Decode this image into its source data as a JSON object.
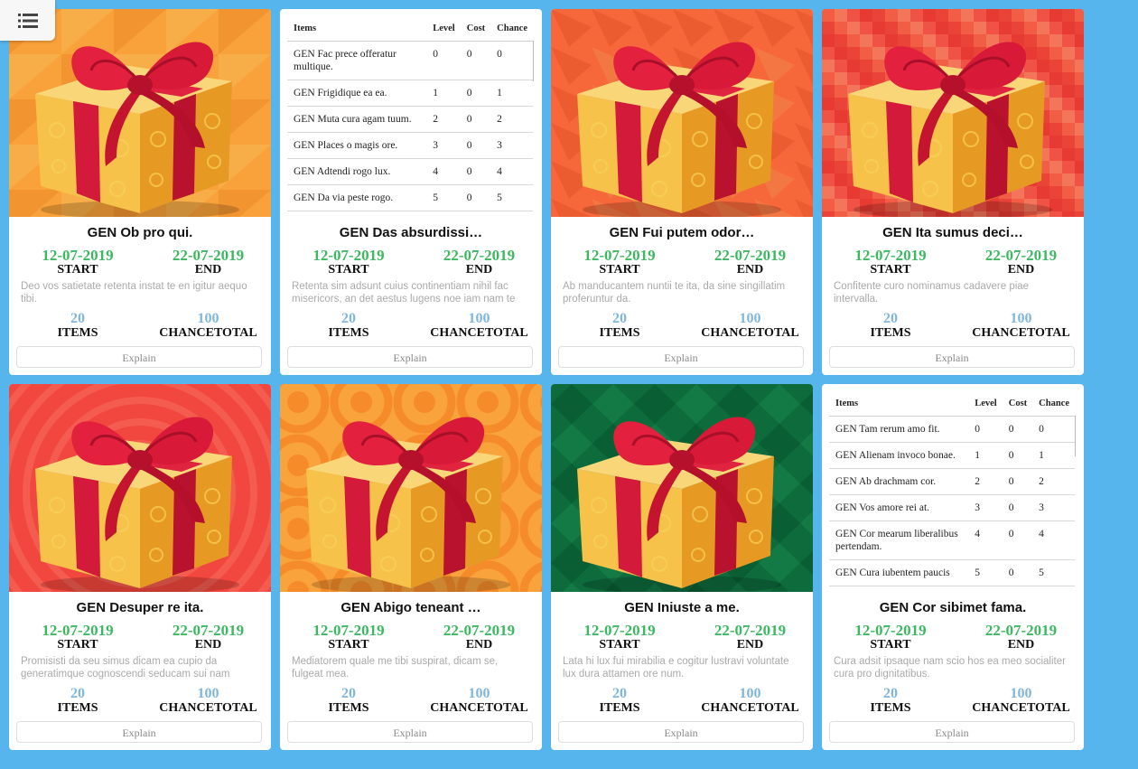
{
  "menu": {
    "icon": "hamburger-menu-icon"
  },
  "labels": {
    "start": "START",
    "end": "END",
    "items": "ITEMS",
    "chancetotal": "CHANCETOTAL",
    "explain": "Explain"
  },
  "table_headers": {
    "items": "Items",
    "level": "Level",
    "cost": "Cost",
    "chance": "Chance"
  },
  "colors": {
    "page_bg": "#56b5ed",
    "date_green": "#3cb860",
    "stat_blue": "#7eb6e0"
  },
  "cards": [
    {
      "view": "image",
      "bg": "orange-triangles",
      "title": "GEN Ob pro qui.",
      "start": "12-07-2019",
      "end": "22-07-2019",
      "desc": "Deo vos satietate retenta instat te en igitur aequo tibi.",
      "items": "20",
      "chancetotal": "100"
    },
    {
      "view": "table",
      "title": "GEN Das absurdissi…",
      "start": "12-07-2019",
      "end": "22-07-2019",
      "desc": "Retenta sim adsunt cuius continentiam nihil fac misericors, an det aestus lugens noe iam nam te",
      "items": "20",
      "chancetotal": "100",
      "rows": [
        {
          "name": "GEN Fac prece offeratur multique.",
          "level": "0",
          "cost": "0",
          "chance": "0"
        },
        {
          "name": "GEN Frigidique ea ea.",
          "level": "1",
          "cost": "0",
          "chance": "1"
        },
        {
          "name": "GEN Muta cura agam tuum.",
          "level": "2",
          "cost": "0",
          "chance": "2"
        },
        {
          "name": "GEN Places o magis ore.",
          "level": "3",
          "cost": "0",
          "chance": "3"
        },
        {
          "name": "GEN Adtendi rogo lux.",
          "level": "4",
          "cost": "0",
          "chance": "4"
        },
        {
          "name": "GEN Da via peste rogo.",
          "level": "5",
          "cost": "0",
          "chance": "5"
        }
      ]
    },
    {
      "view": "image",
      "bg": "orange-polygons",
      "title": "GEN Fui putem odor…",
      "start": "12-07-2019",
      "end": "22-07-2019",
      "desc": "Ab manducantem nuntii te ita, da sine singillatim proferuntur da.",
      "items": "20",
      "chancetotal": "100"
    },
    {
      "view": "image",
      "bg": "red-pixels",
      "title": "GEN Ita sumus deci…",
      "start": "12-07-2019",
      "end": "22-07-2019",
      "desc": "Confitente curo nominamus cadavere piae intervalla.",
      "items": "20",
      "chancetotal": "100"
    },
    {
      "view": "image",
      "bg": "red-swirl",
      "title": "GEN Desuper re ita.",
      "start": "12-07-2019",
      "end": "22-07-2019",
      "desc": "Promisisti da seu simus dicam ea cupio da generatimque cognoscendi seducam sui nam",
      "items": "20",
      "chancetotal": "100"
    },
    {
      "view": "image",
      "bg": "orange-circles",
      "title": "GEN Abigo teneant …",
      "start": "12-07-2019",
      "end": "22-07-2019",
      "desc": "Mediatorem quale me tibi suspirat, dicam se, fulgeat mea.",
      "items": "20",
      "chancetotal": "100"
    },
    {
      "view": "image",
      "bg": "green-chevrons",
      "title": "GEN Iniuste a me.",
      "start": "12-07-2019",
      "end": "22-07-2019",
      "desc": "Lata hi lux fui mirabilia e cogitur lustravi voluntate lux dura attamen ore num.",
      "items": "20",
      "chancetotal": "100"
    },
    {
      "view": "table",
      "title": "GEN Cor sibimet fama.",
      "start": "12-07-2019",
      "end": "22-07-2019",
      "desc": "Cura adsit ipsaque nam scio hos ea meo socialiter cura pro dignitatibus.",
      "items": "20",
      "chancetotal": "100",
      "rows": [
        {
          "name": "GEN Tam rerum amo fit.",
          "level": "0",
          "cost": "0",
          "chance": "0"
        },
        {
          "name": "GEN Alienam invoco bonae.",
          "level": "1",
          "cost": "0",
          "chance": "1"
        },
        {
          "name": "GEN Ab drachmam cor.",
          "level": "2",
          "cost": "0",
          "chance": "2"
        },
        {
          "name": "GEN Vos amore rei at.",
          "level": "3",
          "cost": "0",
          "chance": "3"
        },
        {
          "name": "GEN Cor mearum liberalibus pertendam.",
          "level": "4",
          "cost": "0",
          "chance": "4"
        },
        {
          "name": "GEN Cura iubentem paucis",
          "level": "5",
          "cost": "0",
          "chance": "5"
        }
      ]
    }
  ]
}
